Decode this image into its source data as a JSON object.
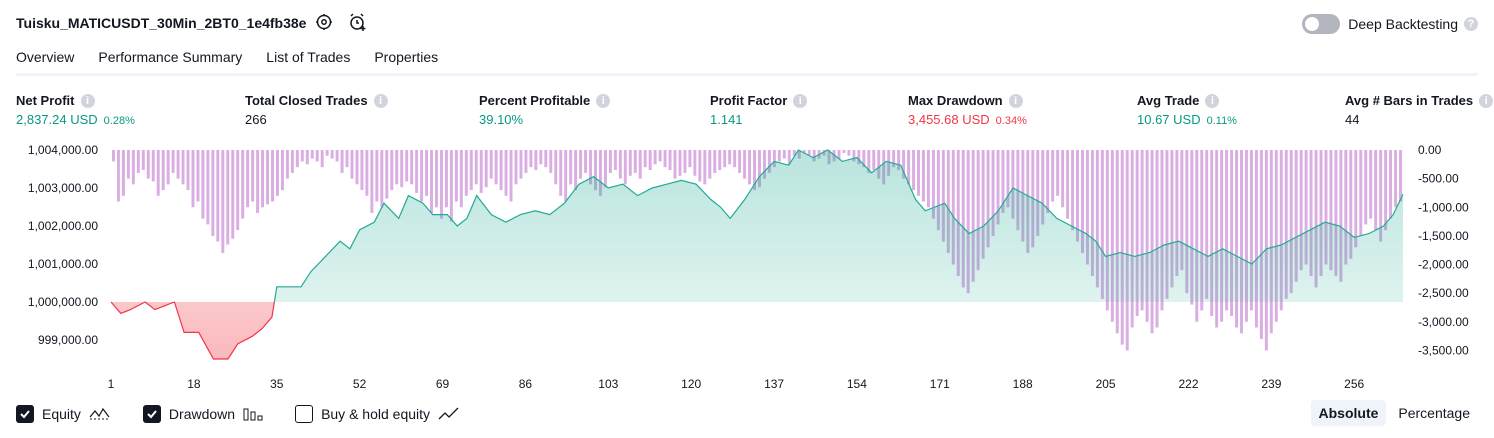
{
  "strategy_title": "Tuisku_MATICUSDT_30Min_2BT0_1e4fb38e",
  "deep_backtesting": {
    "label": "Deep Backtesting",
    "enabled": false
  },
  "tabs": [
    {
      "label": "Overview",
      "active": true
    },
    {
      "label": "Performance Summary",
      "active": false
    },
    {
      "label": "List of Trades",
      "active": false
    },
    {
      "label": "Properties",
      "active": false
    }
  ],
  "metrics": {
    "net_profit": {
      "label": "Net Profit",
      "value": "2,837.24 USD",
      "pct": "0.28%"
    },
    "total_closed_trades": {
      "label": "Total Closed Trades",
      "value": "266"
    },
    "percent_profitable": {
      "label": "Percent Profitable",
      "value": "39.10%"
    },
    "profit_factor": {
      "label": "Profit Factor",
      "value": "1.141"
    },
    "max_drawdown": {
      "label": "Max Drawdown",
      "value": "3,455.68 USD",
      "pct": "0.34%"
    },
    "avg_trade": {
      "label": "Avg Trade",
      "value": "10.67 USD",
      "pct": "0.11%"
    },
    "avg_bars": {
      "label": "Avg # Bars in Trades",
      "value": "44"
    }
  },
  "legend": {
    "equity": {
      "label": "Equity",
      "checked": true
    },
    "drawdown": {
      "label": "Drawdown",
      "checked": true
    },
    "buy_hold": {
      "label": "Buy & hold equity",
      "checked": false
    }
  },
  "modes": {
    "absolute": "Absolute",
    "percentage": "Percentage",
    "selected": "absolute"
  },
  "colors": {
    "equity_line": "#22ab94",
    "equity_fill": "#22ab94",
    "loss_line": "#f23645",
    "loss_fill": "#f23645",
    "drawdown_bar": "#ce93d8",
    "positive_text": "#089981",
    "negative_text": "#f23645"
  },
  "chart_data": {
    "type": "line",
    "x_ticks": [
      "1",
      "18",
      "35",
      "52",
      "69",
      "86",
      "103",
      "120",
      "137",
      "154",
      "171",
      "188",
      "205",
      "222",
      "239",
      "256"
    ],
    "y_left_ticks": [
      "1,004,000.00",
      "1,003,000.00",
      "1,002,000.00",
      "1,001,000.00",
      "1,000,000.00",
      "999,000.00"
    ],
    "y_right_ticks": [
      "0.00",
      "-500.00",
      "-1,000.00",
      "-1,500.00",
      "-2,000.00",
      "-2,500.00",
      "-3,000.00",
      "-3,500.00"
    ],
    "y_left_range": [
      998500,
      1004000
    ],
    "y_right_range": [
      -3650,
      0
    ],
    "x_range": [
      1,
      266
    ],
    "baseline": 1000000,
    "series": [
      {
        "name": "Equity",
        "kind": "line",
        "points": [
          [
            1,
            1000000
          ],
          [
            3,
            999700
          ],
          [
            5,
            999800
          ],
          [
            8,
            1000000
          ],
          [
            10,
            999800
          ],
          [
            12,
            999900
          ],
          [
            14,
            1000000
          ],
          [
            16,
            999200
          ],
          [
            19,
            999200
          ],
          [
            22,
            998500
          ],
          [
            25,
            998500
          ],
          [
            27,
            998900
          ],
          [
            30,
            999100
          ],
          [
            32,
            999300
          ],
          [
            34,
            999600
          ],
          [
            35,
            1000400
          ],
          [
            40,
            1000400
          ],
          [
            42,
            1000800
          ],
          [
            45,
            1001200
          ],
          [
            48,
            1001600
          ],
          [
            50,
            1001400
          ],
          [
            52,
            1001900
          ],
          [
            55,
            1002100
          ],
          [
            57,
            1002600
          ],
          [
            60,
            1002200
          ],
          [
            62,
            1002800
          ],
          [
            65,
            1002600
          ],
          [
            67,
            1002300
          ],
          [
            70,
            1002300
          ],
          [
            72,
            1002000
          ],
          [
            74,
            1002200
          ],
          [
            76,
            1002800
          ],
          [
            79,
            1002300
          ],
          [
            82,
            1002100
          ],
          [
            85,
            1002300
          ],
          [
            88,
            1002400
          ],
          [
            91,
            1002300
          ],
          [
            94,
            1002600
          ],
          [
            97,
            1003100
          ],
          [
            100,
            1003300
          ],
          [
            103,
            1003000
          ],
          [
            106,
            1003100
          ],
          [
            109,
            1002800
          ],
          [
            112,
            1003000
          ],
          [
            115,
            1003100
          ],
          [
            118,
            1003200
          ],
          [
            121,
            1003100
          ],
          [
            124,
            1002700
          ],
          [
            126,
            1002500
          ],
          [
            128,
            1002200
          ],
          [
            131,
            1002700
          ],
          [
            134,
            1003300
          ],
          [
            137,
            1003700
          ],
          [
            140,
            1003600
          ],
          [
            142,
            1004000
          ],
          [
            145,
            1003800
          ],
          [
            148,
            1004000
          ],
          [
            151,
            1003700
          ],
          [
            154,
            1003800
          ],
          [
            157,
            1003400
          ],
          [
            160,
            1003700
          ],
          [
            163,
            1003600
          ],
          [
            166,
            1002700
          ],
          [
            168,
            1002400
          ],
          [
            170,
            1002500
          ],
          [
            172,
            1002600
          ],
          [
            174,
            1002200
          ],
          [
            177,
            1001800
          ],
          [
            180,
            1002000
          ],
          [
            183,
            1002400
          ],
          [
            186,
            1003000
          ],
          [
            189,
            1002800
          ],
          [
            192,
            1002600
          ],
          [
            195,
            1002200
          ],
          [
            198,
            1002000
          ],
          [
            201,
            1001800
          ],
          [
            203,
            1001600
          ],
          [
            205,
            1001200
          ],
          [
            208,
            1001300
          ],
          [
            211,
            1001200
          ],
          [
            214,
            1001300
          ],
          [
            217,
            1001500
          ],
          [
            220,
            1001600
          ],
          [
            223,
            1001400
          ],
          [
            226,
            1001200
          ],
          [
            229,
            1001400
          ],
          [
            232,
            1001200
          ],
          [
            235,
            1001000
          ],
          [
            238,
            1001400
          ],
          [
            241,
            1001500
          ],
          [
            244,
            1001700
          ],
          [
            247,
            1001900
          ],
          [
            250,
            1002100
          ],
          [
            253,
            1002000
          ],
          [
            256,
            1001700
          ],
          [
            259,
            1001800
          ],
          [
            262,
            1002000
          ],
          [
            264,
            1002300
          ],
          [
            266,
            1002837
          ]
        ]
      },
      {
        "name": "Drawdown",
        "kind": "bars",
        "values": [
          -200,
          -900,
          -800,
          -500,
          -600,
          -400,
          -350,
          -500,
          -550,
          -800,
          -700,
          -600,
          -400,
          -500,
          -600,
          -700,
          -1000,
          -900,
          -1200,
          -1300,
          -1500,
          -1600,
          -1800,
          -1650,
          -1550,
          -1400,
          -1200,
          -1000,
          -900,
          -1100,
          -1000,
          -950,
          -900,
          -800,
          -700,
          -500,
          -400,
          -300,
          -200,
          -250,
          -150,
          -200,
          -300,
          -100,
          -150,
          -200,
          -400,
          -300,
          -500,
          -600,
          -700,
          -800,
          -1100,
          -900,
          -1000,
          -850,
          -700,
          -600,
          -650,
          -550,
          -600,
          -750,
          -900,
          -800,
          -1100,
          -1000,
          -1200,
          -1000,
          -1250,
          -900,
          -1000,
          -800,
          -700,
          -600,
          -750,
          -650,
          -500,
          -600,
          -700,
          -800,
          -900,
          -600,
          -500,
          -400,
          -300,
          -350,
          -250,
          -300,
          -400,
          -600,
          -800,
          -900,
          -600,
          -700,
          -500,
          -400,
          -600,
          -700,
          -800,
          -650,
          -400,
          -350,
          -500,
          -600,
          -450,
          -400,
          -500,
          -300,
          -350,
          -250,
          -200,
          -300,
          -350,
          -500,
          -450,
          -400,
          -300,
          -450,
          -550,
          -600,
          -500,
          -400,
          -350,
          -300,
          -250,
          -300,
          -400,
          -500,
          -600,
          -700,
          -650,
          -500,
          -400,
          -300,
          -200,
          -150,
          -250,
          -100,
          -150,
          -50,
          -100,
          -200,
          -150,
          -100,
          -250,
          -200,
          -150,
          -50,
          -100,
          -200,
          -250,
          -300,
          -400,
          -350,
          -500,
          -600,
          -450,
          -300,
          -350,
          -500,
          -600,
          -700,
          -800,
          -900,
          -1000,
          -1200,
          -1400,
          -1600,
          -1800,
          -2000,
          -2200,
          -2400,
          -2500,
          -2300,
          -2100,
          -1900,
          -1700,
          -1500,
          -1300,
          -1100,
          -1000,
          -1200,
          -1400,
          -1600,
          -1800,
          -1700,
          -1500,
          -1300,
          -1100,
          -900,
          -800,
          -1000,
          -1200,
          -1400,
          -1600,
          -1800,
          -2000,
          -2200,
          -2400,
          -2600,
          -2800,
          -3000,
          -3200,
          -3400,
          -3500,
          -3100,
          -2900,
          -2800,
          -3000,
          -3200,
          -3100,
          -2800,
          -2600,
          -2400,
          -2200,
          -2100,
          -2500,
          -2700,
          -3000,
          -2800,
          -2600,
          -2900,
          -3100,
          -3000,
          -2800,
          -2900,
          -3100,
          -3200,
          -3000,
          -2800,
          -3100,
          -3300,
          -3500,
          -3200,
          -3000,
          -2800,
          -2600,
          -2500,
          -2300,
          -2100,
          -2000,
          -2200,
          -2400,
          -2200,
          -2000,
          -2100,
          -2200,
          -2300,
          -2000,
          -1900,
          -1700,
          -1500,
          -1300,
          -1200,
          -1400,
          -1600,
          -1400,
          -1200,
          -1000,
          -900
        ]
      }
    ]
  }
}
